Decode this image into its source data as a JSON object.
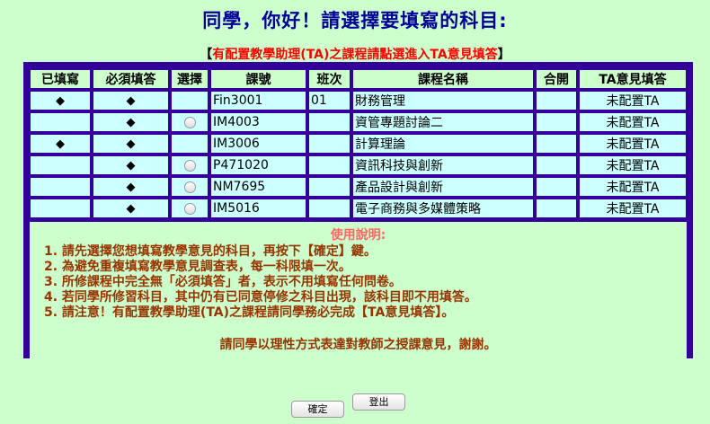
{
  "title": "同學，你好！請選擇要填寫的科目:",
  "ta_notice": {
    "open_bracket": "【",
    "text": "有配置教學助理(TA)之課程請點選進入TA意見填答",
    "close_bracket": "】"
  },
  "table": {
    "headers": [
      "已填寫",
      "必須填答",
      "選擇",
      "課號",
      "班次",
      "課程名稱",
      "合開",
      "TA意見填答"
    ],
    "rows": [
      {
        "filled": "◆",
        "required": "◆",
        "select": false,
        "code": "Fin3001",
        "section": "01",
        "name": "財務管理",
        "joint": "",
        "ta": "未配置TA"
      },
      {
        "filled": "",
        "required": "◆",
        "select": true,
        "code": "IM4003",
        "section": "",
        "name": "資管專題討論二",
        "joint": "",
        "ta": "未配置TA"
      },
      {
        "filled": "◆",
        "required": "◆",
        "select": false,
        "code": "IM3006",
        "section": "",
        "name": "計算理論",
        "joint": "",
        "ta": "未配置TA"
      },
      {
        "filled": "",
        "required": "◆",
        "select": true,
        "code": "P471020",
        "section": "",
        "name": "資訊科技與創新",
        "joint": "",
        "ta": "未配置TA"
      },
      {
        "filled": "",
        "required": "◆",
        "select": true,
        "code": "NM7695",
        "section": "",
        "name": "產品設計與創新",
        "joint": "",
        "ta": "未配置TA"
      },
      {
        "filled": "",
        "required": "◆",
        "select": true,
        "code": "IM5016",
        "section": "",
        "name": "電子商務與多媒體策略",
        "joint": "",
        "ta": "未配置TA"
      }
    ]
  },
  "instructions": {
    "title": "使用說明:",
    "items": [
      "1. 請先選擇您想填寫教學意見的科目，再按下【確定】鍵。",
      "2. 為避免重複填寫教學意見調查表，每一科限填一次。",
      "3. 所修課程中完全無「必須填答」者，表示不用填寫任何問卷。",
      "4. 若同學所修習科目，其中仍有已同意停修之科目出現，該科目即不用填答。",
      "5. 請注意！有配置教學助理(TA)之課程請同學務必完成【TA意見填答】。"
    ],
    "closing": "請同學以理性方式表達對教師之授課意見，謝謝。"
  },
  "buttons": {
    "confirm": "確定",
    "logout": "登出"
  },
  "colors": {
    "background": "#ccffcc",
    "title": "#000099",
    "frame": "#330099",
    "cell": "#ccffff",
    "notice_red": "#ff0000",
    "instructions_text": "#993300"
  }
}
